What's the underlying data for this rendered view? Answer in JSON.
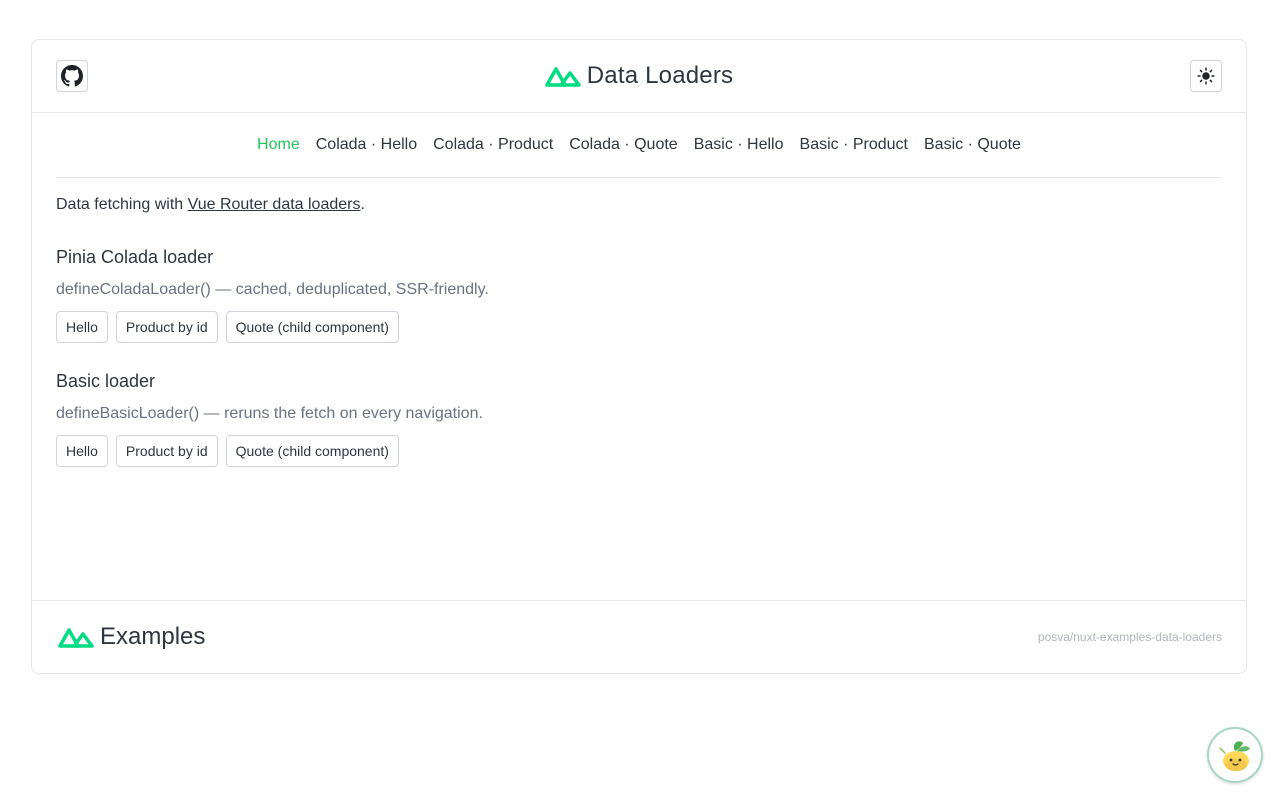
{
  "header": {
    "title": "Data Loaders",
    "github_icon": "github-icon",
    "theme_icon": "sun-icon",
    "logo_icon": "nuxt-logo-icon"
  },
  "nav": {
    "items": [
      {
        "label": "Home",
        "active": true
      },
      {
        "label": "Colada · Hello",
        "active": false
      },
      {
        "label": "Colada · Product",
        "active": false
      },
      {
        "label": "Colada · Quote",
        "active": false
      },
      {
        "label": "Basic · Hello",
        "active": false
      },
      {
        "label": "Basic · Product",
        "active": false
      },
      {
        "label": "Basic · Quote",
        "active": false
      }
    ]
  },
  "intro": {
    "prefix": "Data fetching with ",
    "link": "Vue Router data loaders",
    "suffix": "."
  },
  "sections": [
    {
      "title": "Pinia Colada loader",
      "description": "defineColadaLoader() — cached, deduplicated, SSR-friendly.",
      "buttons": [
        "Hello",
        "Product by id",
        "Quote (child component)"
      ]
    },
    {
      "title": "Basic loader",
      "description": "defineBasicLoader() — reruns the fetch on every navigation.",
      "buttons": [
        "Hello",
        "Product by id",
        "Quote (child component)"
      ]
    }
  ],
  "footer": {
    "title": "Examples",
    "repo": "posva/nuxt-examples-data-loaders"
  },
  "colors": {
    "accent": "#22c55e",
    "logo": "#00dc82",
    "text": "#2f3640",
    "muted": "#6b7280",
    "border": "#e5e7eb"
  }
}
